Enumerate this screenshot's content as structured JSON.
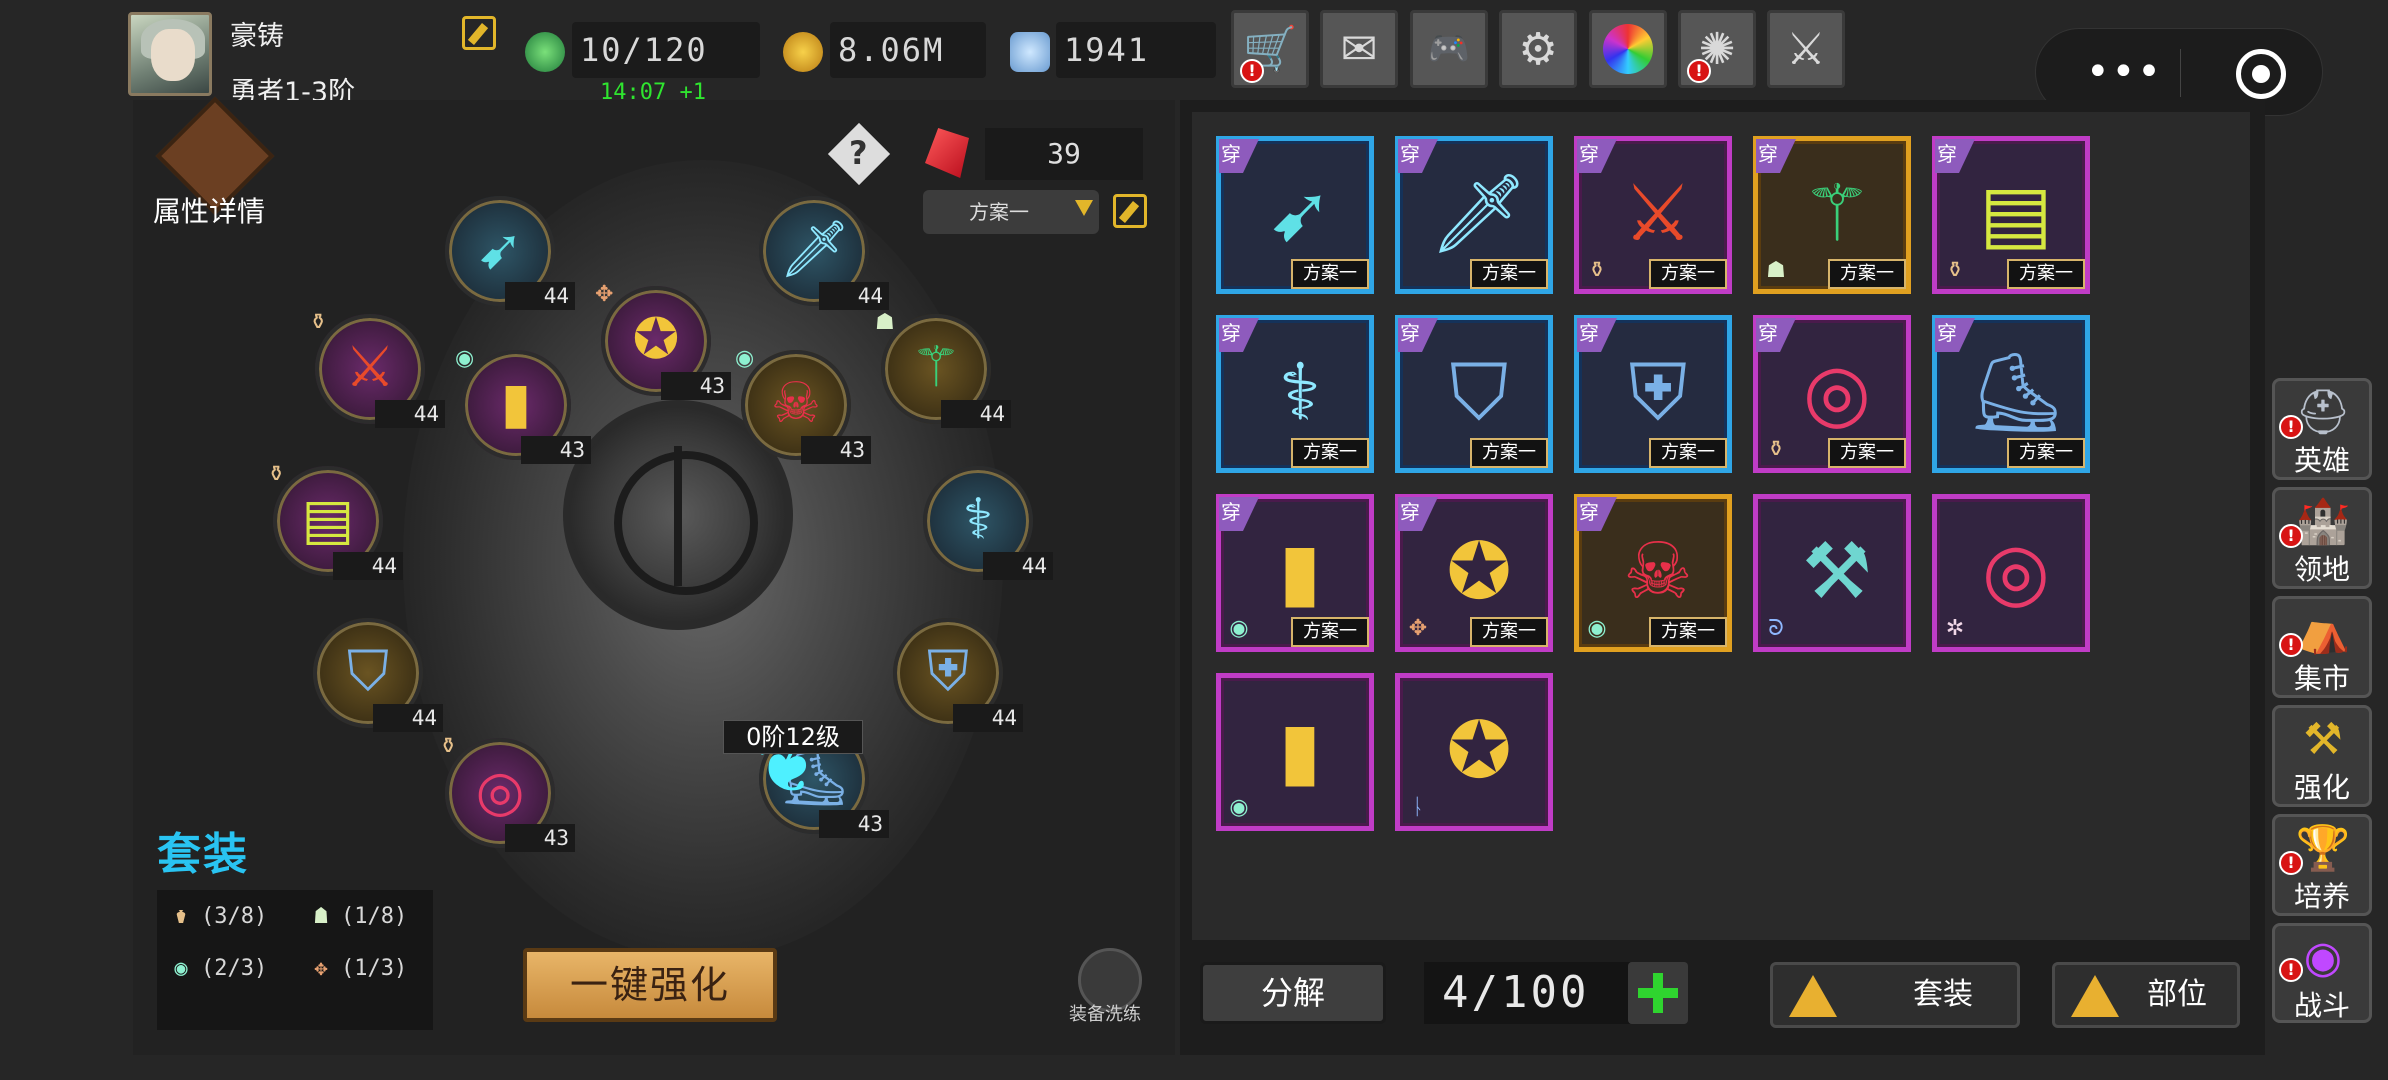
{
  "player": {
    "name": "豪铸",
    "rank": "勇者1-3阶"
  },
  "resources": {
    "stamina": "10/120",
    "stamina_timer": "14:07 +1",
    "gold": "8.06M",
    "diamond": "1941"
  },
  "top_buttons": [
    {
      "icon": "cart-icon",
      "alert": true
    },
    {
      "icon": "mail-icon",
      "alert": false
    },
    {
      "icon": "gamepad-icon",
      "alert": false
    },
    {
      "icon": "gear-icon",
      "alert": false
    },
    {
      "icon": "color-wheel-icon",
      "alert": false
    },
    {
      "icon": "firework-icon",
      "alert": true
    },
    {
      "icon": "crossed-swords-icon",
      "alert": false
    }
  ],
  "equip_panel": {
    "stat_detail_label": "属性详情",
    "ruby_count": "39",
    "plan_selected": "方案一",
    "center_level": "0阶12级",
    "slots": [
      {
        "name": "bow",
        "level": "44"
      },
      {
        "name": "blade",
        "level": "44"
      },
      {
        "name": "axe-red",
        "level": "44"
      },
      {
        "name": "bracer",
        "level": "43"
      },
      {
        "name": "amulet",
        "level": "43"
      },
      {
        "name": "helmet-demon",
        "level": "43"
      },
      {
        "name": "scythe",
        "level": "44"
      },
      {
        "name": "tome",
        "level": "44"
      },
      {
        "name": "staff",
        "level": "44"
      },
      {
        "name": "helmet-blue",
        "level": "44"
      },
      {
        "name": "armor",
        "level": "44"
      },
      {
        "name": "ring",
        "level": "43"
      },
      {
        "name": "boots",
        "level": "43"
      }
    ],
    "suit_title": "套装",
    "suit_counts": [
      "(3/8)",
      "(1/8)",
      "(2/3)",
      "(1/3)"
    ],
    "enhance_button": "一键强化",
    "reforge_label": "装备洗练"
  },
  "inventory": {
    "wear_label": "穿",
    "plan_label": "方案一",
    "items": [
      {
        "icon": "bow-icon",
        "rarity": "blue",
        "worn": true
      },
      {
        "icon": "blade-icon",
        "rarity": "blue",
        "worn": true
      },
      {
        "icon": "sword-icon",
        "rarity": "purple",
        "worn": true
      },
      {
        "icon": "scythe-icon",
        "rarity": "gold",
        "worn": true
      },
      {
        "icon": "tome-icon",
        "rarity": "purple",
        "worn": true
      },
      {
        "icon": "staff-icon",
        "rarity": "blue",
        "worn": true
      },
      {
        "icon": "helmet-icon",
        "rarity": "blue",
        "worn": true
      },
      {
        "icon": "armor-icon",
        "rarity": "blue",
        "worn": true
      },
      {
        "icon": "ring-icon",
        "rarity": "purple",
        "worn": true
      },
      {
        "icon": "boots-icon",
        "rarity": "blue",
        "worn": true
      },
      {
        "icon": "bracer-icon",
        "rarity": "purple",
        "worn": true
      },
      {
        "icon": "amulet-icon",
        "rarity": "purple",
        "worn": true
      },
      {
        "icon": "demon-mask-icon",
        "rarity": "gold",
        "worn": true
      },
      {
        "icon": "axe-icon",
        "rarity": "purple",
        "worn": false
      },
      {
        "icon": "ring-icon",
        "rarity": "purple",
        "worn": false
      },
      {
        "icon": "bracer-icon",
        "rarity": "purple",
        "worn": false
      },
      {
        "icon": "amulet-icon",
        "rarity": "purple",
        "worn": false
      }
    ],
    "decompose_button": "分解",
    "capacity": "4/100",
    "filter_suit": "套装",
    "filter_slot": "部位"
  },
  "side_nav": [
    {
      "label": "英雄",
      "icon": "helmet-icon",
      "alert": true
    },
    {
      "label": "领地",
      "icon": "castle-icon",
      "alert": true
    },
    {
      "label": "集市",
      "icon": "market-icon",
      "alert": true
    },
    {
      "label": "强化",
      "icon": "anvil-icon",
      "alert": false
    },
    {
      "label": "培养",
      "icon": "chalice-icon",
      "alert": true
    },
    {
      "label": "战斗",
      "icon": "portal-icon",
      "alert": true
    }
  ],
  "colors": {
    "rarity_blue": "#2fa6e6",
    "rarity_purple": "#c03cc6",
    "rarity_gold": "#e0a020",
    "accent_gold": "#e2b62a",
    "suit_title": "#29c4f2",
    "timer_green": "#2fe52f"
  }
}
